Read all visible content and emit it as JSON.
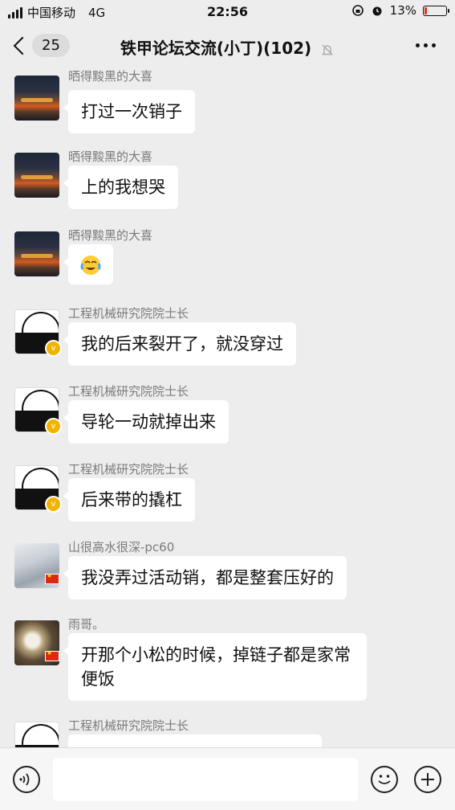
{
  "status_bar": {
    "carrier": "中国移动",
    "network": "4G",
    "time": "22:56",
    "battery_percent": "13%",
    "battery_level": 0.13
  },
  "nav": {
    "back_count": "25",
    "title": "铁甲论坛交流(小丁)(102)"
  },
  "messages": [
    {
      "sender": "晒得黢黑的大喜",
      "text": "打过一次销子",
      "avatar": "sunset"
    },
    {
      "sender": "晒得黢黑的大喜",
      "text": "上的我想哭",
      "avatar": "sunset"
    },
    {
      "sender": "晒得黢黑的大喜",
      "text": "",
      "avatar": "sunset",
      "emoji": "face-with-tears-emoji"
    },
    {
      "sender": "工程机械研究院院士长",
      "text": "我的后来裂开了，就没穿过",
      "avatar": "crest"
    },
    {
      "sender": "工程机械研究院院士长",
      "text": "导轮一动就掉出来",
      "avatar": "crest"
    },
    {
      "sender": "工程机械研究院院士长",
      "text": "后来带的撬杠",
      "avatar": "crest"
    },
    {
      "sender": "山很高水很深-pc60",
      "text": "我没弄过活动销，都是整套压好的",
      "avatar": "anime"
    },
    {
      "sender": "雨哥。",
      "text": "开那个小松的时候，掉链子都是家常便饭",
      "avatar": "cat"
    },
    {
      "sender": "工程机械研究院院士长",
      "text": "",
      "avatar": "crest"
    }
  ],
  "input_bar": {
    "placeholder": ""
  }
}
